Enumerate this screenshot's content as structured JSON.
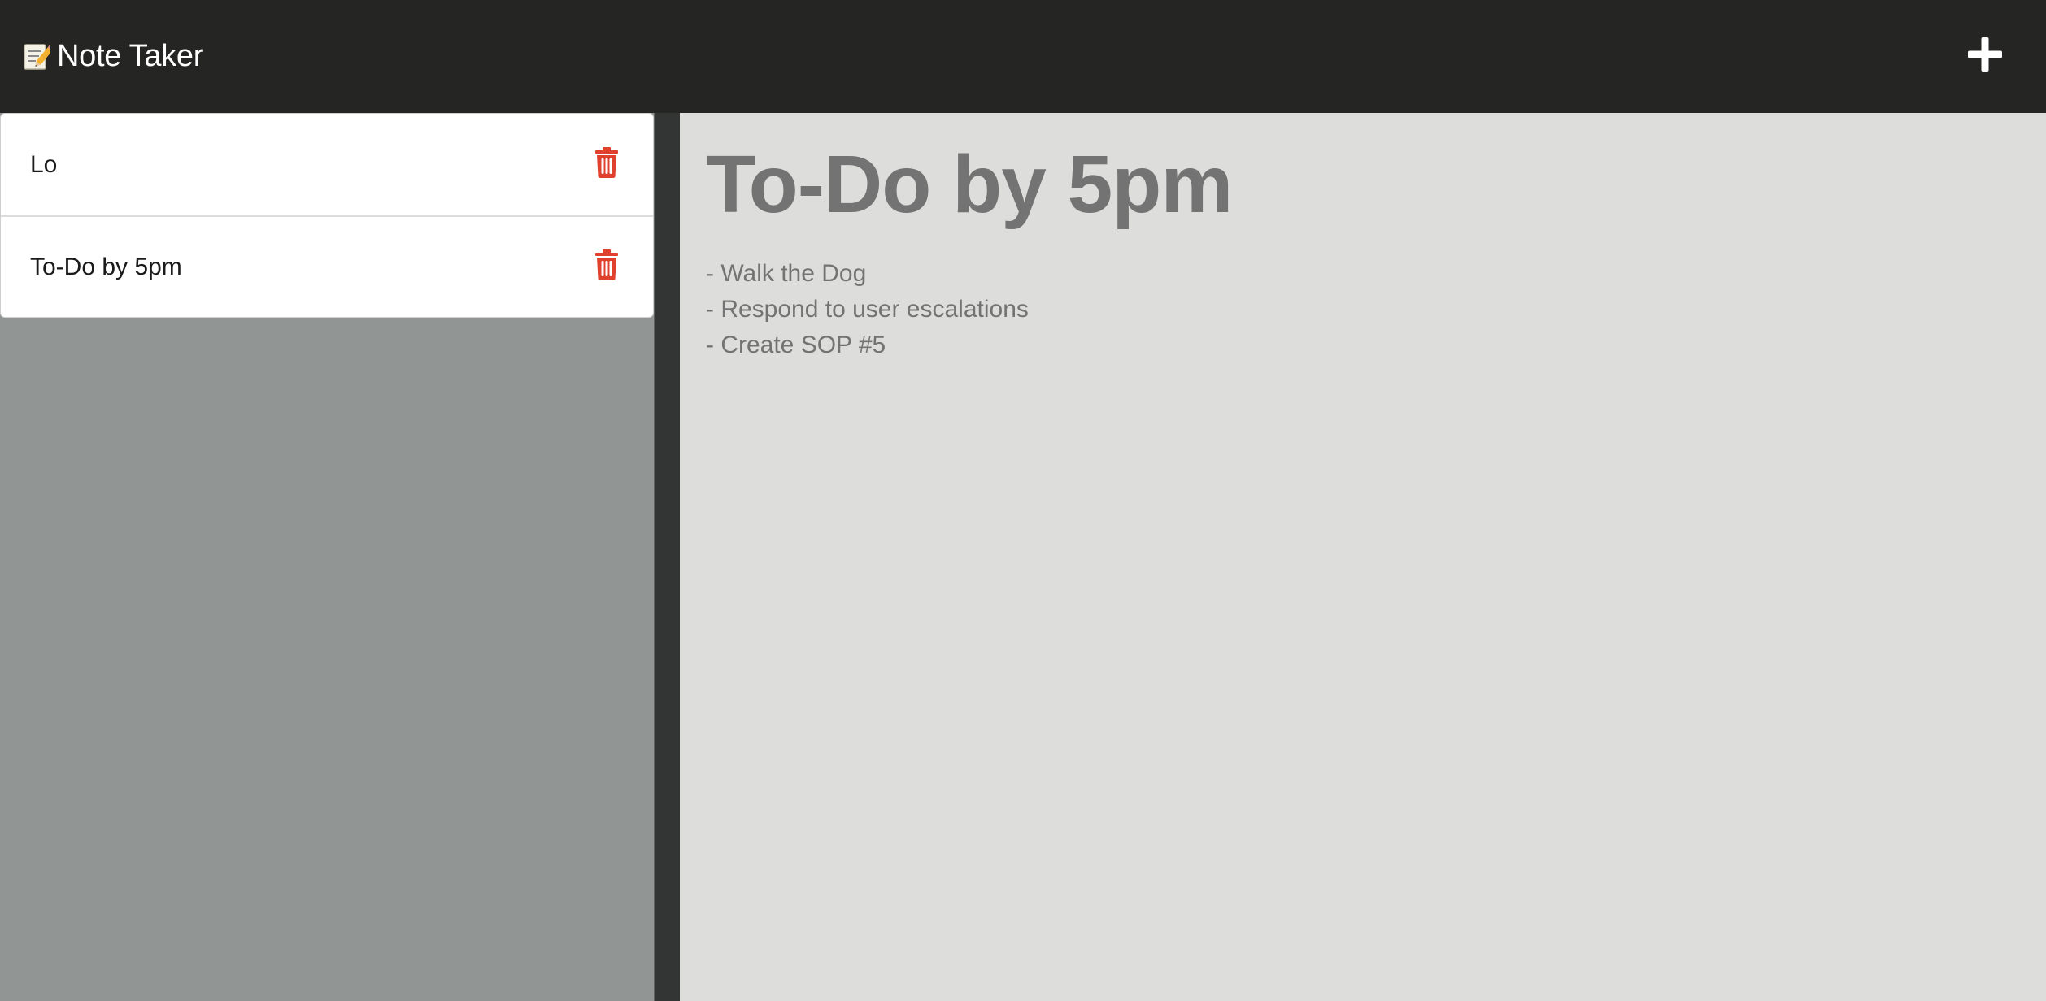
{
  "app": {
    "title": "Note Taker",
    "brand_icon": "memo-icon",
    "new_note_icon": "plus-icon"
  },
  "sidebar": {
    "notes": [
      {
        "title": "Lo",
        "delete_icon": "trash-icon"
      },
      {
        "title": "To-Do by 5pm",
        "delete_icon": "trash-icon"
      }
    ]
  },
  "editor": {
    "title": "To-Do by 5pm",
    "lines": [
      "- Walk the Dog",
      "- Respond to user escalations",
      "- Create SOP #5"
    ]
  },
  "colors": {
    "navbar": "#252524",
    "sidebar": "#919695",
    "editor_bg": "#dddddc",
    "delete": "#e0412f",
    "text_muted": "#737373"
  }
}
